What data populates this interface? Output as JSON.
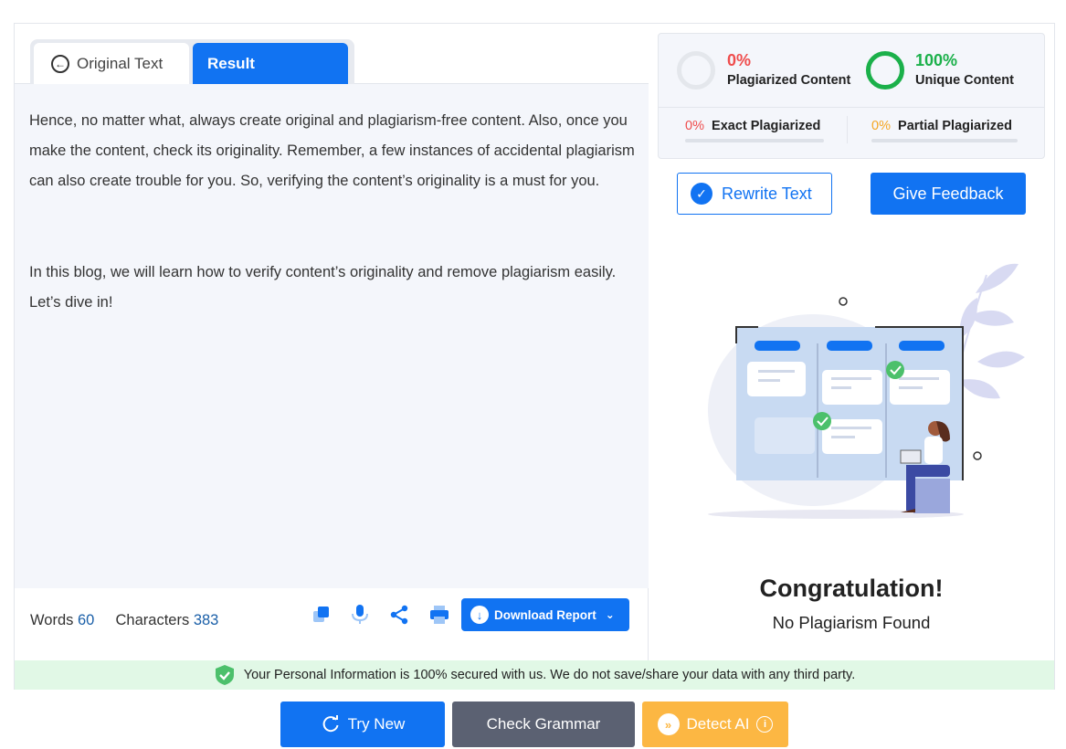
{
  "tabs": {
    "original": "Original Text",
    "result": "Result"
  },
  "content": {
    "paragraph1": "Hence, no matter what, always create original and plagiarism-free content. Also, once you make the content, check its originality. Remember, a few instances of accidental plagiarism can also create trouble for you. So, verifying the content’s originality is a must for you.",
    "paragraph2": "In this blog, we will learn how to verify content’s originality and remove plagiarism easily. Let’s dive in!"
  },
  "stats_bar": {
    "words_label": "Words",
    "words_value": "60",
    "chars_label": "Characters",
    "chars_value": "383",
    "icons": [
      "copy-icon",
      "microphone-icon",
      "share-icon",
      "print-icon"
    ],
    "download_label": "Download Report"
  },
  "results": {
    "plagiarized_pct": "0%",
    "plagiarized_label": "Plagiarized Content",
    "unique_pct": "100%",
    "unique_label": "Unique Content",
    "exact_pct": "0%",
    "exact_label": "Exact Plagiarized",
    "partial_pct": "0%",
    "partial_label": "Partial Plagiarized",
    "rewrite_label": "Rewrite Text",
    "feedback_label": "Give Feedback",
    "congrats_title": "Congratulation!",
    "congrats_sub": "No Plagiarism Found"
  },
  "security": {
    "text": "Your Personal Information is 100% secured with us. We do not save/share your data with any third party."
  },
  "actions": {
    "try_new": "Try New",
    "check_grammar": "Check Grammar",
    "detect_ai": "Detect AI"
  },
  "colors": {
    "primary": "#1173f2",
    "success": "#1bb04a",
    "danger": "#ef4d4d",
    "warning": "#f5a623",
    "grammar_button": "#5b6172",
    "ai_button": "#fcb743"
  }
}
